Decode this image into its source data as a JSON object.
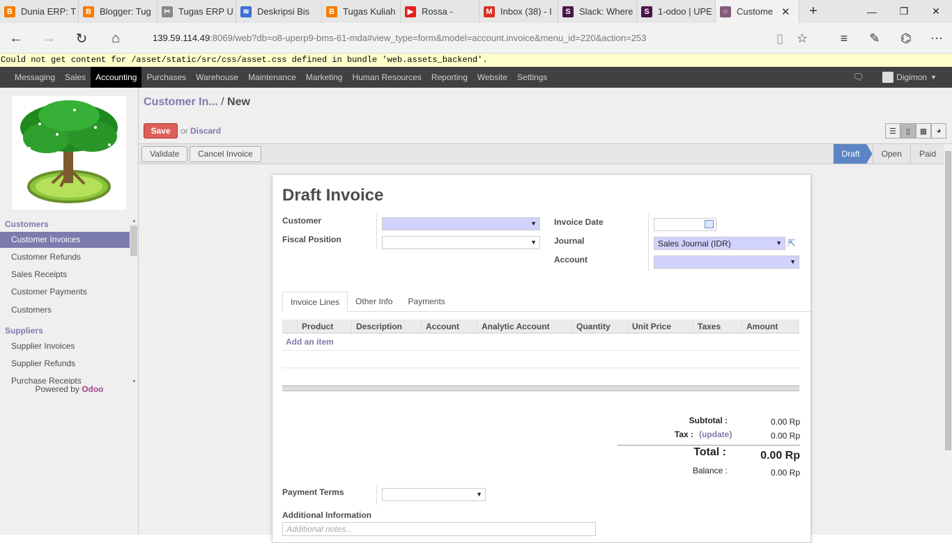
{
  "browser": {
    "tabs": [
      {
        "title": "Dunia ERP: T",
        "icon_color": "#f57d00",
        "icon": "B"
      },
      {
        "title": "Blogger: Tug",
        "icon_color": "#f57d00",
        "icon": "B"
      },
      {
        "title": "Tugas ERP U",
        "icon_color": "#888888",
        "icon": "✂"
      },
      {
        "title": "Deskripsi Bis",
        "icon_color": "#3b6fd8",
        "icon": "≋"
      },
      {
        "title": "Tugas Kuliah",
        "icon_color": "#f57d00",
        "icon": "B"
      },
      {
        "title": "Rossa - ",
        "icon_color": "#e62117",
        "icon": "▶"
      },
      {
        "title": "Inbox (38) - I",
        "icon_color": "#d93025",
        "icon": "M"
      },
      {
        "title": "Slack: Where",
        "icon_color": "#4a154b",
        "icon": "S"
      },
      {
        "title": "1-odoo | UPE",
        "icon_color": "#4a154b",
        "icon": "S"
      },
      {
        "title": "Custome",
        "icon_color": "#875a7b",
        "icon": "○"
      }
    ],
    "url_host": "139.59.114.49",
    "url_rest": ":8069/web?db=o8-uperp9-bms-61-mda#view_type=form&model=account.invoice&menu_id=220&action=253"
  },
  "warning": "Could not get content for /asset/static/src/css/asset.css defined in bundle 'web.assets_backend'.",
  "topmenu": {
    "items": [
      "Messaging",
      "Sales",
      "Accounting",
      "Purchases",
      "Warehouse",
      "Maintenance",
      "Marketing",
      "Human Resources",
      "Reporting",
      "Website",
      "Settings"
    ],
    "user": "Digimon"
  },
  "sidebar": {
    "customers_head": "Customers",
    "customer_items": [
      "Customer Invoices",
      "Customer Refunds",
      "Sales Receipts",
      "Customer Payments",
      "Customers"
    ],
    "suppliers_head": "Suppliers",
    "supplier_items": [
      "Supplier Invoices",
      "Supplier Refunds",
      "Purchase Receipts"
    ],
    "powered_prefix": "Powered by",
    "powered_brand": "Odoo"
  },
  "breadcrumb": {
    "parent": "Customer In...",
    "current": "New"
  },
  "actions": {
    "save": "Save",
    "or": "or",
    "discard": "Discard"
  },
  "statusbar": {
    "validate": "Validate",
    "cancel": "Cancel Invoice",
    "stages": [
      "Draft",
      "Open",
      "Paid"
    ]
  },
  "form": {
    "title": "Draft Invoice",
    "customer_label": "Customer",
    "fiscal_label": "Fiscal Position",
    "invoice_date_label": "Invoice Date",
    "journal_label": "Journal",
    "journal_value": "Sales Journal (IDR)",
    "account_label": "Account",
    "tabs": [
      "Invoice Lines",
      "Other Info",
      "Payments"
    ],
    "columns": [
      "Product",
      "Description",
      "Account",
      "Analytic Account",
      "Quantity",
      "Unit Price",
      "Taxes",
      "Amount"
    ],
    "add_item": "Add an item",
    "subtotal_label": "Subtotal :",
    "subtotal_value": "0.00 Rp",
    "tax_label": "Tax :",
    "tax_update": "(update)",
    "tax_value": "0.00 Rp",
    "total_label": "Total :",
    "total_value": "0.00 Rp",
    "balance_label": "Balance :",
    "balance_value": "0.00 Rp",
    "payment_terms_label": "Payment Terms",
    "additional_info_label": "Additional Information",
    "notes_placeholder": "Additional notes..."
  }
}
